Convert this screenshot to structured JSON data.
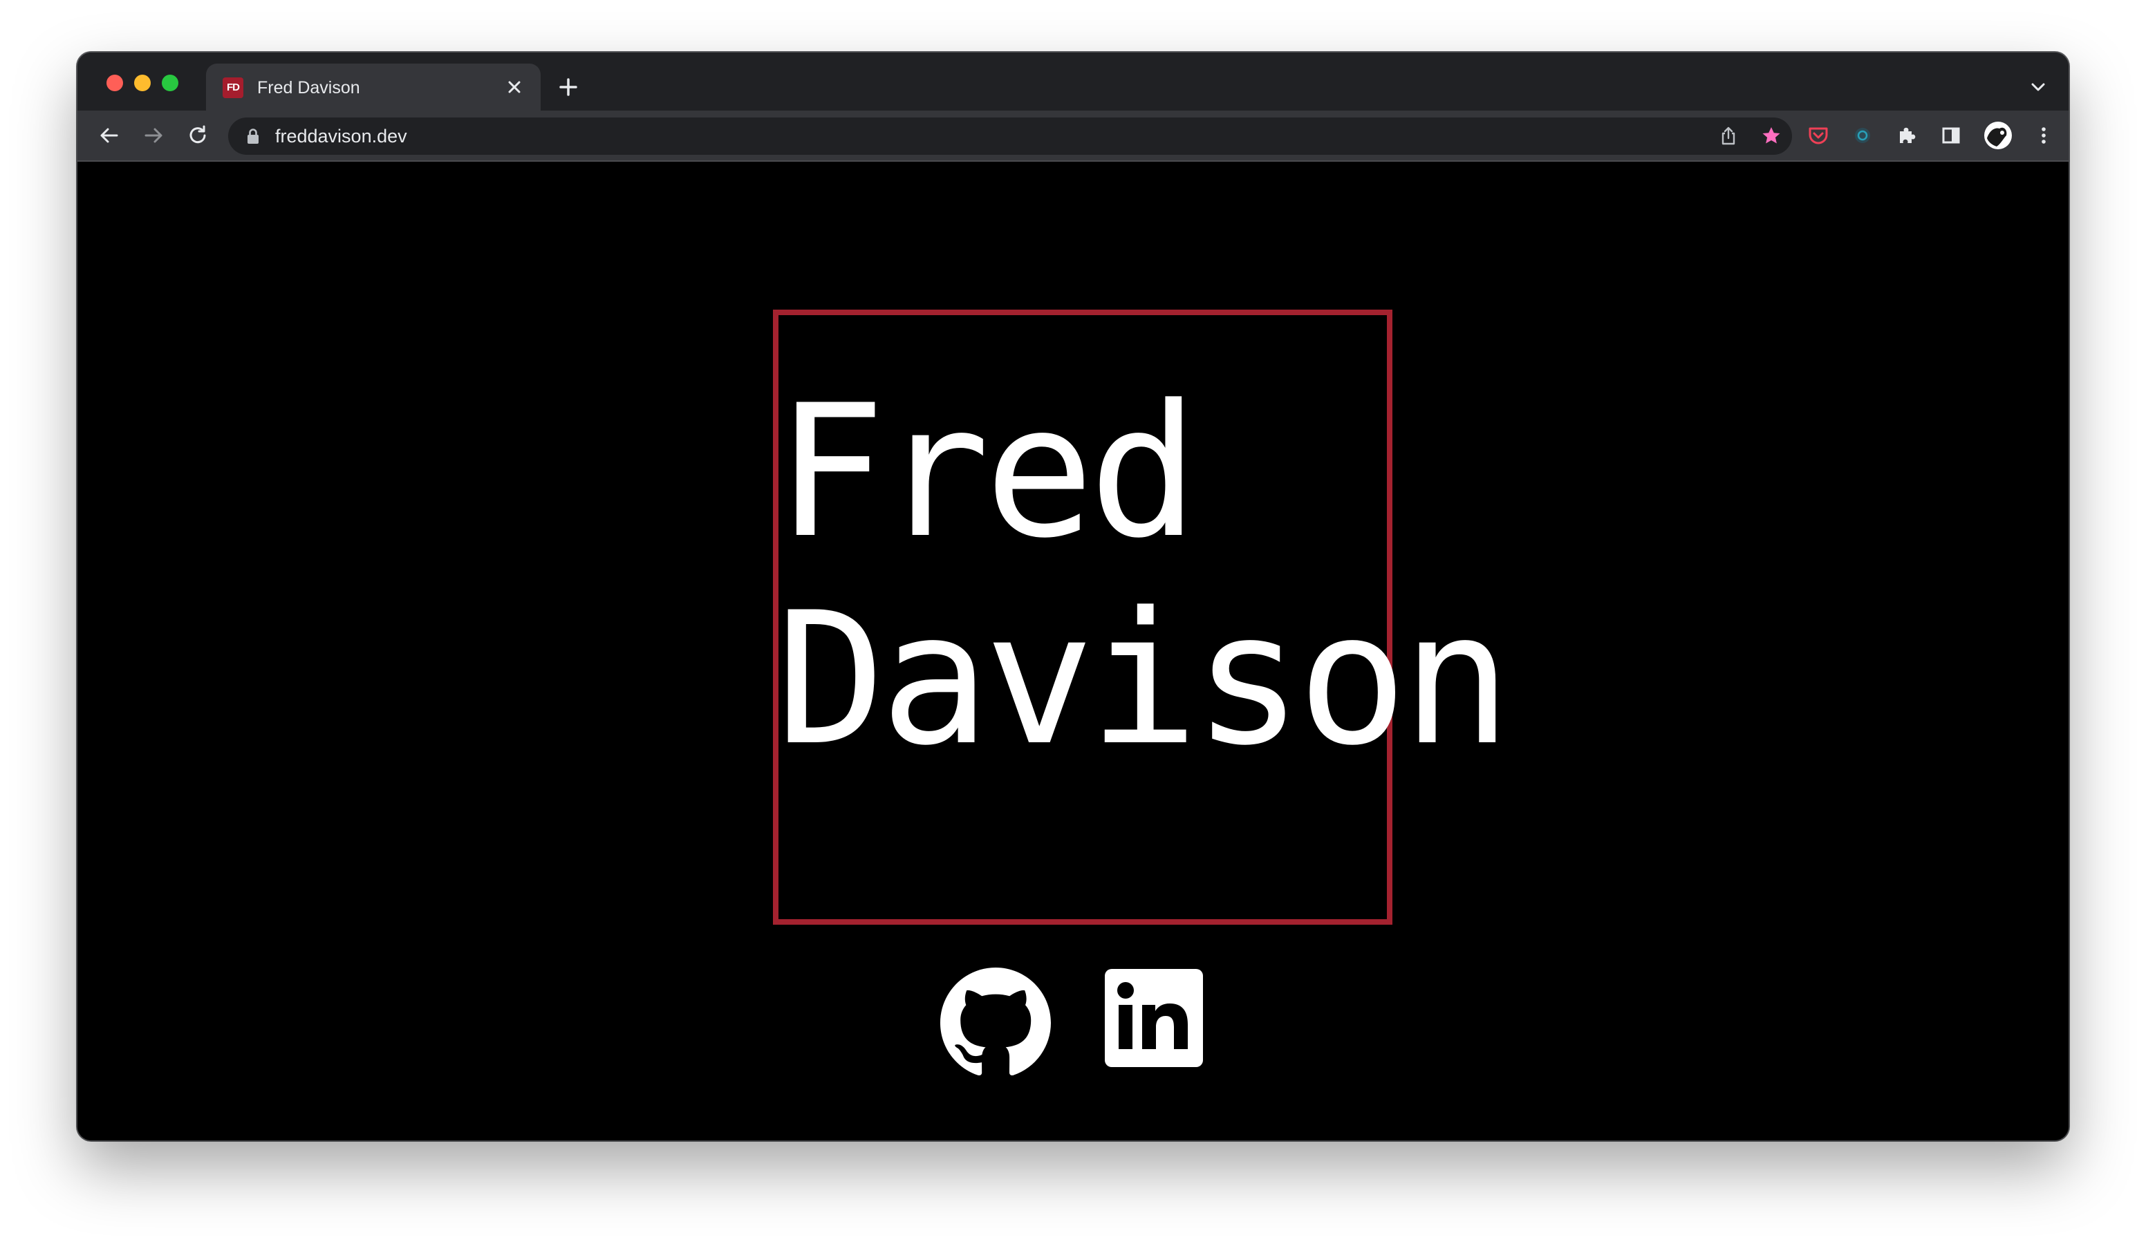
{
  "browser": {
    "tab": {
      "favicon_text": "FD",
      "title": "Fred Davison",
      "close_icon": "close-icon"
    },
    "new_tab_icon": "plus-icon",
    "tab_search_icon": "chevron-down-icon",
    "toolbar": {
      "back_icon": "arrow-left-icon",
      "forward_icon": "arrow-right-icon",
      "reload_icon": "reload-icon",
      "url": "freddavison.dev",
      "lock_icon": "lock-icon",
      "share_icon": "share-icon",
      "bookmark_icon": "star-icon",
      "extensions": [
        "pocket-icon",
        "extension-circle-icon",
        "puzzle-icon"
      ],
      "side_panel_icon": "side-panel-icon",
      "profile_icon": "avatar",
      "menu_icon": "kebab-menu-icon"
    },
    "colors": {
      "tabstrip": "#202124",
      "toolbar": "#35363a",
      "bookmark_star": "#ff6fc0",
      "pocket": "#ef4056"
    }
  },
  "page": {
    "name_first": "Fred",
    "name_last": "Davison",
    "accent_color": "#a4222f",
    "background": "#000000",
    "social_links": [
      {
        "icon": "github-icon",
        "label": "GitHub"
      },
      {
        "icon": "linkedin-icon",
        "label": "LinkedIn"
      }
    ]
  }
}
